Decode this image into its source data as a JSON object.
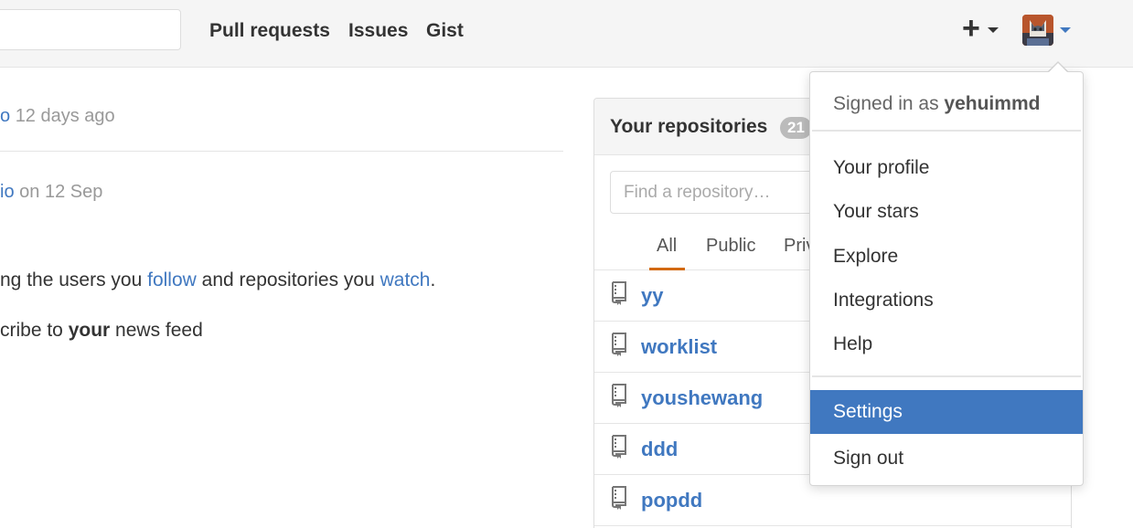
{
  "header": {
    "nav": {
      "pull_requests": "Pull requests",
      "issues": "Issues",
      "gist": "Gist"
    },
    "new_button_icon": "plus-icon",
    "avatar_icon": "user-avatar"
  },
  "feed": {
    "event1": {
      "link": "o",
      "time": "12 days ago"
    },
    "event2": {
      "link": "io",
      "time": "on 12 Sep"
    },
    "info": {
      "pre": "ng the users you ",
      "follow": "follow",
      "mid": " and repositories you ",
      "watch": "watch",
      "post": "."
    },
    "subscribe": {
      "pre": "cribe to ",
      "bold": "your",
      "post": " news feed"
    }
  },
  "repos": {
    "title": "Your repositories",
    "count": "21",
    "filter_placeholder": "Find a repository…",
    "tabs": {
      "all": "All",
      "public": "Public",
      "private": "Private"
    },
    "items": [
      "yy",
      "worklist",
      "youshewang",
      "ddd",
      "popdd"
    ],
    "icon": "repo-icon"
  },
  "dropdown": {
    "signed_in_prefix": "Signed in as ",
    "username": "yehuimmd",
    "items": [
      "Your profile",
      "Your stars",
      "Explore",
      "Integrations",
      "Help"
    ],
    "settings": "Settings",
    "sign_out": "Sign out"
  },
  "colors": {
    "link": "#4078c0",
    "active_item": "#4078c0",
    "tab_underline": "#d26911",
    "header_bg": "#f5f5f5"
  }
}
